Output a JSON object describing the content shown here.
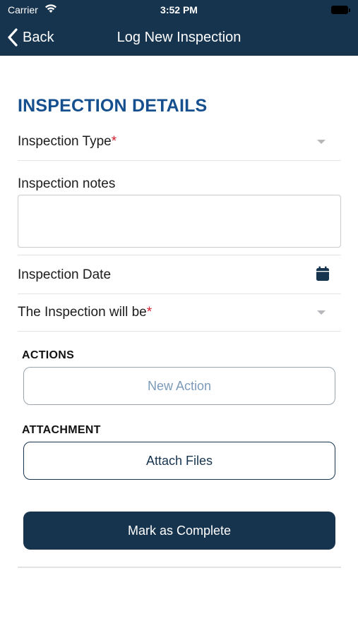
{
  "status_bar": {
    "carrier": "Carrier",
    "time": "3:52 PM"
  },
  "nav": {
    "back_label": "Back",
    "title": "Log New Inspection"
  },
  "form": {
    "section_title": "INSPECTION DETAILS",
    "inspection_type_label": "Inspection Type",
    "required_mark": "*",
    "notes_label": "Inspection notes",
    "notes_value": "",
    "inspection_date_label": "Inspection Date",
    "inspection_will_be_label": "The Inspection will be"
  },
  "actions": {
    "heading": "ACTIONS",
    "new_action_label": "New Action"
  },
  "attachment": {
    "heading": "ATTACHMENT",
    "attach_files_label": "Attach Files"
  },
  "footer": {
    "mark_complete_label": "Mark as Complete"
  },
  "icons": {
    "wifi": "wifi-icon",
    "battery": "battery-icon",
    "back": "chevron-left-icon",
    "dropdown": "caret-down-icon",
    "calendar": "calendar-icon"
  },
  "colors": {
    "header_bg": "#17344f",
    "section_title": "#164f8e",
    "required": "#d21f2d",
    "primary_button": "#17344f",
    "disabled_text": "#7b9bb8"
  }
}
